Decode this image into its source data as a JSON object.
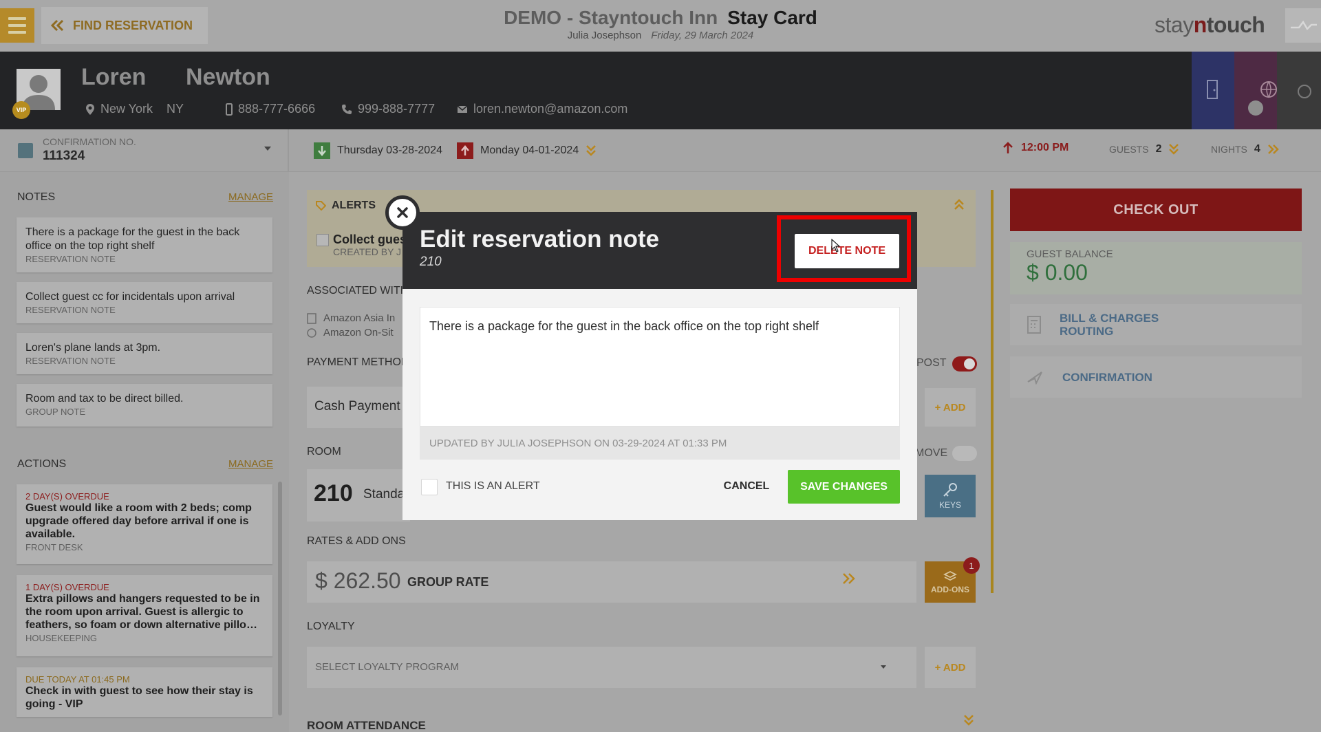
{
  "header": {
    "find_reservation": "FIND RESERVATION",
    "hotel": "DEMO - Stayntouch Inn",
    "screen": "Stay Card",
    "user": "Julia Josephson",
    "date": "Friday, 29 March 2024",
    "brand_pre": "stay",
    "brand_n": "n",
    "brand_post": "touch"
  },
  "guest": {
    "first_name": "Loren",
    "last_name": "Newton",
    "vip": "VIP",
    "city": "New York",
    "state": "NY",
    "mobile": "888-777-6666",
    "phone": "999-888-7777",
    "email": "loren.newton@amazon.com"
  },
  "reservation": {
    "confirmation_label": "CONFIRMATION NO.",
    "confirmation_no": "111324",
    "arrival": "Thursday 03-28-2024",
    "departure": "Monday 04-01-2024",
    "time": "12:00 PM",
    "guests_label": "GUESTS",
    "guests": "2",
    "nights_label": "NIGHTS",
    "nights": "4"
  },
  "notes": {
    "title": "NOTES",
    "manage": "MANAGE",
    "items": [
      {
        "text": "There is a package for the guest in the back office on the top right shelf",
        "type": "RESERVATION NOTE"
      },
      {
        "text": "Collect guest cc for incidentals upon arrival",
        "type": "RESERVATION NOTE"
      },
      {
        "text": "Loren's plane lands at 3pm.",
        "type": "RESERVATION NOTE"
      },
      {
        "text": "Room and tax to be direct billed.",
        "type": "GROUP NOTE"
      }
    ]
  },
  "actions": {
    "title": "ACTIONS",
    "manage": "MANAGE",
    "items": [
      {
        "status": "2 DAY(S) OVERDUE",
        "text": "Guest would like a room with 2 beds; comp upgrade offered day before arrival if one is available.",
        "dept": "FRONT DESK"
      },
      {
        "status": "1 DAY(S) OVERDUE",
        "text": "Extra pillows and hangers requested to be in the room upon arrival. Guest is allergic to feathers, so foam or down alternative pillo…",
        "dept": "HOUSEKEEPING"
      },
      {
        "status": "DUE TODAY AT 01:45 PM",
        "text": "Check in with guest to see how their stay is going - VIP",
        "dept": ""
      }
    ]
  },
  "center": {
    "alerts_title": "ALERTS",
    "alert_text": "Collect gues",
    "alert_created": "CREATED BY J",
    "associated_label": "ASSOCIATED WITH",
    "associated": [
      "Amazon Asia In",
      "Amazon On-Sit"
    ],
    "payment_label": "PAYMENT METHOD",
    "payment_value": "Cash Payment",
    "post_label": "POST",
    "add_label": "+ ADD",
    "room_label": "ROOM",
    "room_no": "210",
    "room_type": "Standa",
    "move_label": "MOVE",
    "keys_label": "KEYS",
    "rates_label": "RATES & ADD ONS",
    "rate_amount": "$ 262.50",
    "rate_name": "GROUP RATE",
    "addons_label": "ADD-ONS",
    "addons_count": "1",
    "loyalty_label": "LOYALTY",
    "loyalty_placeholder": "SELECT LOYALTY PROGRAM",
    "add_label2": "+ ADD",
    "room_attendance": "ROOM ATTENDANCE"
  },
  "right": {
    "checkout": "CHECK OUT",
    "balance_label": "GUEST BALANCE",
    "balance": "$ 0.00",
    "bill_line1": "BILL & CHARGES",
    "bill_line2": "ROUTING",
    "confirmation": "CONFIRMATION"
  },
  "modal": {
    "title": "Edit reservation note",
    "subtitle": "210",
    "delete_label": "DELETE NOTE",
    "note_text": "There is a package for the guest in the back office on the top right shelf",
    "updated": "UPDATED BY JULIA JOSEPHSON ON 03-29-2024 AT 01:33 PM",
    "alert_checkbox_label": "THIS IS AN ALERT",
    "cancel_label": "CANCEL",
    "save_label": "SAVE CHANGES"
  },
  "colors": {
    "accent": "#b9871e",
    "checkout": "#7e1616",
    "save": "#58c22a",
    "delete_text": "#c52121",
    "highlight": "#ee0000"
  }
}
